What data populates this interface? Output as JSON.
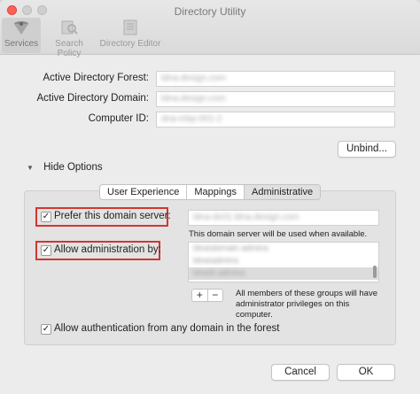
{
  "window": {
    "title": "Directory Utility"
  },
  "toolbar": {
    "services": "Services",
    "search_policy": "Search Policy",
    "directory_editor": "Directory Editor"
  },
  "fields": {
    "forest_label": "Active Directory Forest:",
    "forest_value": "ldna.design.com",
    "domain_label": "Active Directory Domain:",
    "domain_value": "ldna.design.com",
    "computer_label": "Computer ID:",
    "computer_value": "dna-mbp-001-2"
  },
  "buttons": {
    "unbind": "Unbind...",
    "cancel": "Cancel",
    "ok": "OK"
  },
  "options": {
    "toggle_label": "Hide Options"
  },
  "tabs": [
    {
      "label": "User Experience"
    },
    {
      "label": "Mappings"
    },
    {
      "label": "Administrative"
    }
  ],
  "admin": {
    "prefer_label": "Prefer this domain server:",
    "prefer_value": "ldna-dc01.ldna.design.com",
    "prefer_note": "This domain server will be used when available.",
    "allow_admin_label": "Allow administration by:",
    "groups": [
      "ldna\\domain admins",
      "ldna\\admins",
      "ldna\\it admins"
    ],
    "groups_note": "All members of these groups will have administrator privileges on this computer.",
    "add": "+",
    "remove": "−",
    "allow_auth_label": "Allow authentication from any domain in the forest"
  },
  "colors": {
    "highlight": "#d0372f"
  }
}
